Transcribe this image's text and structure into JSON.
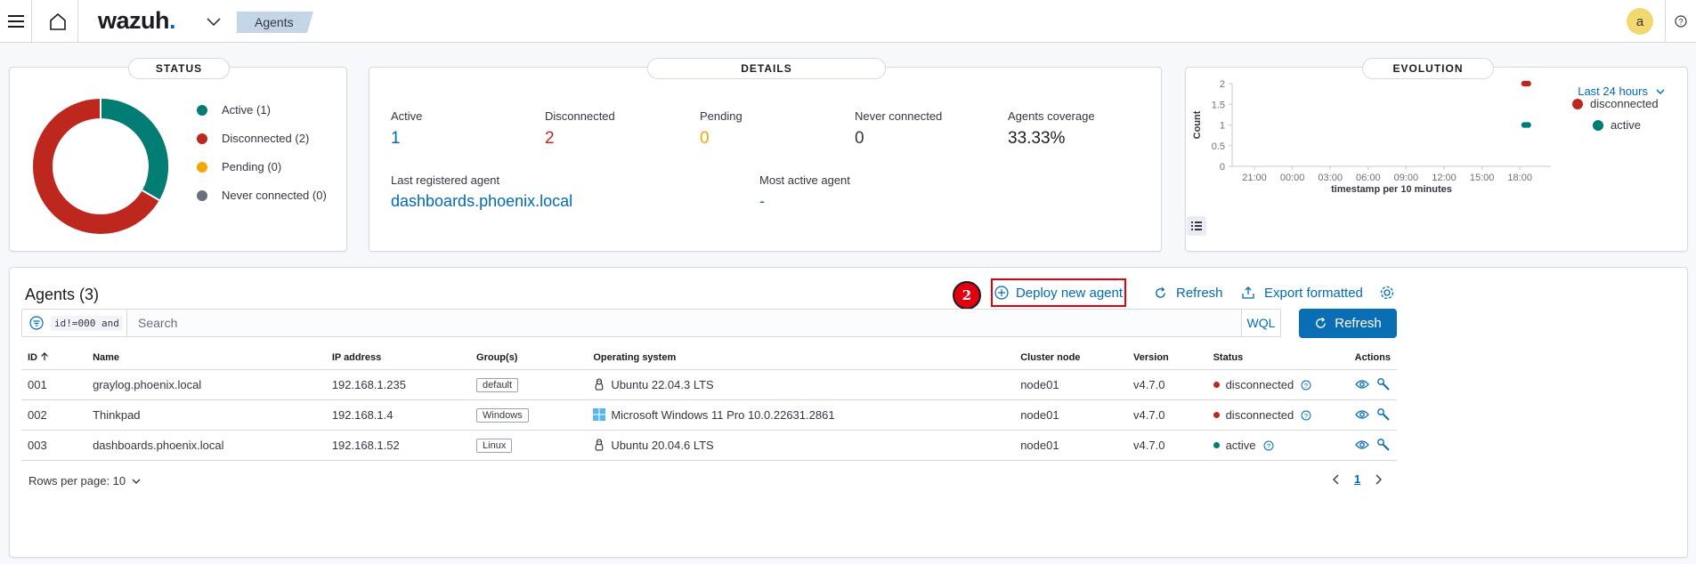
{
  "topbar": {
    "logo_text": "wazuh",
    "logo_dot": ".",
    "breadcrumb": "Agents",
    "avatar_letter": "a",
    "icons": [
      "menu-icon",
      "home-icon",
      "chevron-down-icon",
      "help-icon"
    ]
  },
  "status": {
    "title": "STATUS",
    "legend": [
      {
        "label": "Active (1)",
        "color": "#017d73"
      },
      {
        "label": "Disconnected (2)",
        "color": "#bd271e"
      },
      {
        "label": "Pending (0)",
        "color": "#f5a700"
      },
      {
        "label": "Never connected (0)",
        "color": "#69707d"
      }
    ]
  },
  "details": {
    "title": "DETAILS",
    "active_label": "Active",
    "active_value": "1",
    "disconnected_label": "Disconnected",
    "disconnected_value": "2",
    "pending_label": "Pending",
    "pending_value": "0",
    "never_label": "Never connected",
    "never_value": "0",
    "coverage_label": "Agents coverage",
    "coverage_value": "33.33%",
    "last_registered_label": "Last registered agent",
    "last_registered_value": "dashboards.phoenix.local",
    "most_active_label": "Most active agent",
    "most_active_value": "-"
  },
  "evolution": {
    "title": "EVOLUTION",
    "range_label": "Last 24 hours",
    "legend": [
      {
        "label": "disconnected",
        "color": "#bd271e"
      },
      {
        "label": "active",
        "color": "#017d73"
      }
    ]
  },
  "chart_data": {
    "type": "line",
    "title": "",
    "xlabel": "timestamp per 10 minutes",
    "ylabel": "Count",
    "x_ticks": [
      "21:00",
      "00:00",
      "03:00",
      "06:00",
      "09:00",
      "12:00",
      "15:00",
      "18:00"
    ],
    "y_ticks": [
      "0",
      "0.5",
      "1",
      "1.5",
      "2"
    ],
    "ylim": [
      0,
      2
    ],
    "series": [
      {
        "name": "disconnected",
        "color": "#bd271e",
        "points": [
          [
            "18:20",
            2
          ],
          [
            "18:30",
            2
          ],
          [
            "18:40",
            2
          ]
        ]
      },
      {
        "name": "active",
        "color": "#017d73",
        "points": [
          [
            "18:20",
            1
          ],
          [
            "18:30",
            1
          ],
          [
            "18:40",
            1
          ]
        ]
      }
    ],
    "legend": "top-right",
    "grid": false
  },
  "agents": {
    "title": "Agents (3)",
    "step_badge": "2",
    "deploy_label": "Deploy new agent",
    "refresh_link_label": "Refresh",
    "export_label": "Export formatted",
    "search_filter": "id!=000 and",
    "search_placeholder": "Search",
    "wql_label": "WQL",
    "refresh_button_label": "Refresh",
    "columns": {
      "id": "ID",
      "name": "Name",
      "ip": "IP address",
      "groups": "Group(s)",
      "os": "Operating system",
      "node": "Cluster node",
      "version": "Version",
      "status": "Status",
      "actions": "Actions"
    },
    "rows": [
      {
        "id": "001",
        "name": "graylog.phoenix.local",
        "ip": "192.168.1.235",
        "group": "default",
        "os": "Ubuntu 22.04.3 LTS",
        "os_icon": "linux-icon",
        "node": "node01",
        "version": "v4.7.0",
        "status": "disconnected",
        "status_color": "#bd271e"
      },
      {
        "id": "002",
        "name": "Thinkpad",
        "ip": "192.168.1.4",
        "group": "Windows",
        "os": "Microsoft Windows 11 Pro 10.0.22631.2861",
        "os_icon": "windows-icon",
        "node": "node01",
        "version": "v4.7.0",
        "status": "disconnected",
        "status_color": "#bd271e"
      },
      {
        "id": "003",
        "name": "dashboards.phoenix.local",
        "ip": "192.168.1.52",
        "group": "Linux",
        "os": "Ubuntu 20.04.6 LTS",
        "os_icon": "linux-icon",
        "node": "node01",
        "version": "v4.7.0",
        "status": "active",
        "status_color": "#017d73"
      }
    ],
    "rows_per_page_label": "Rows per page: 10",
    "current_page": "1"
  }
}
